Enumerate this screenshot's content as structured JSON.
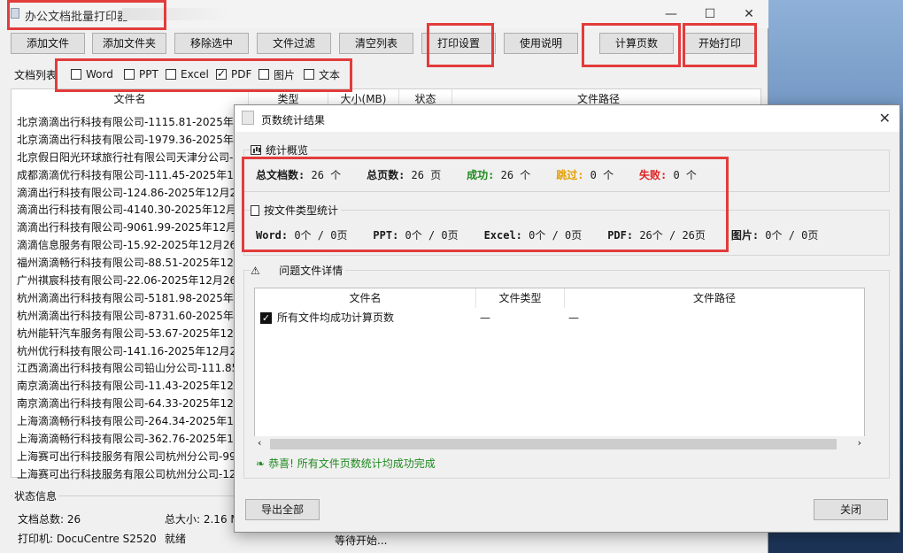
{
  "app": {
    "title": "办公文档批量打印器",
    "window_controls": {
      "minimize": "—",
      "maximize": "☐",
      "close": "✕"
    }
  },
  "toolbar": {
    "add_file": "添加文件",
    "add_folder": "添加文件夹",
    "remove_selected": "移除选中",
    "file_filter": "文件过滤",
    "clear_list": "清空列表",
    "print_settings": "打印设置",
    "instructions": "使用说明",
    "count_pages": "计算页数",
    "start_print": "开始打印"
  },
  "filters": {
    "group_label": "文档列表",
    "items": [
      {
        "label": "Word",
        "checked": false
      },
      {
        "label": "PPT",
        "checked": false
      },
      {
        "label": "Excel",
        "checked": false
      },
      {
        "label": "PDF",
        "checked": true
      },
      {
        "label": "图片",
        "checked": false
      },
      {
        "label": "文本",
        "checked": false
      }
    ]
  },
  "file_list": {
    "columns": [
      "文件名",
      "类型",
      "大小(MB)",
      "状态",
      "文件路径"
    ],
    "rows": [
      "北京滴滴出行科技有限公司-1115.81-2025年1",
      "北京滴滴出行科技有限公司-1979.36-2025年1",
      "北京假日阳光环球旅行社有限公司天津分公司-",
      "成都滴滴优行科技有限公司-111.45-2025年12",
      "滴滴出行科技有限公司-124.86-2025年12月26",
      "滴滴出行科技有限公司-4140.30-2025年12月2",
      "滴滴出行科技有限公司-9061.99-2025年12月2",
      "滴滴信息服务有限公司-15.92-2025年12月26日",
      "福州滴滴畅行科技有限公司-88.51-2025年12月",
      "广州祺宸科技有限公司-22.06-2025年12月26日",
      "杭州滴滴出行科技有限公司-5181.98-2025年1",
      "杭州滴滴出行科技有限公司-8731.60-2025年1",
      "杭州能轩汽车服务有限公司-53.67-2025年12月",
      "杭州优行科技有限公司-141.16-2025年12月26",
      "江西滴滴出行科技有限公司铅山分公司-111.85",
      "南京滴滴出行科技有限公司-11.43-2025年12月",
      "南京滴滴出行科技有限公司-64.33-2025年12月",
      "上海滴滴畅行科技有限公司-264.34-2025年12",
      "上海滴滴畅行科技有限公司-362.76-2025年12",
      "上海赛可出行科技服务有限公司杭州分公司-99",
      "上海赛可出行科技服务有限公司杭州分公司-12"
    ]
  },
  "status": {
    "group_label": "状态信息",
    "total_docs": "文档总数: 26",
    "total_size": "总大小: 2.16 M",
    "printer": "打印机: DocuCentre S2520",
    "printer_state": "就绪",
    "waiting": "等待开始..."
  },
  "dialog": {
    "title": "页数统计结果",
    "overview": {
      "title": "统计概览",
      "total_docs_label": "总文档数:",
      "total_docs_value": "26 个",
      "total_pages_label": "总页数:",
      "total_pages_value": "26 页",
      "success_label": "成功:",
      "success_value": "26 个",
      "skipped_label": "跳过:",
      "skipped_value": "0 个",
      "failed_label": "失败:",
      "failed_value": "0 个"
    },
    "by_type": {
      "title": "按文件类型统计",
      "word_label": "Word:",
      "word_value": "0个 / 0页",
      "ppt_label": "PPT:",
      "ppt_value": "0个 / 0页",
      "excel_label": "Excel:",
      "excel_value": "0个 / 0页",
      "pdf_label": "PDF:",
      "pdf_value": "26个 / 26页",
      "image_label": "图片:",
      "image_value": "0个 / 0页"
    },
    "problems": {
      "title": "问题文件详情",
      "warning_icon": "⚠",
      "columns": [
        "文件名",
        "文件类型",
        "文件路径"
      ],
      "row": {
        "name": "所有文件均成功计算页数",
        "type": "—",
        "path": "—"
      }
    },
    "message_icon": "❧",
    "message": "恭喜! 所有文件页数统计均成功完成",
    "export_button": "导出全部",
    "close_button": "关闭",
    "close_x": "✕"
  },
  "colors": {
    "highlight": "#e23c3c",
    "success": "#1e8a1e",
    "skipped": "#e3a000",
    "failed": "#e02020"
  }
}
